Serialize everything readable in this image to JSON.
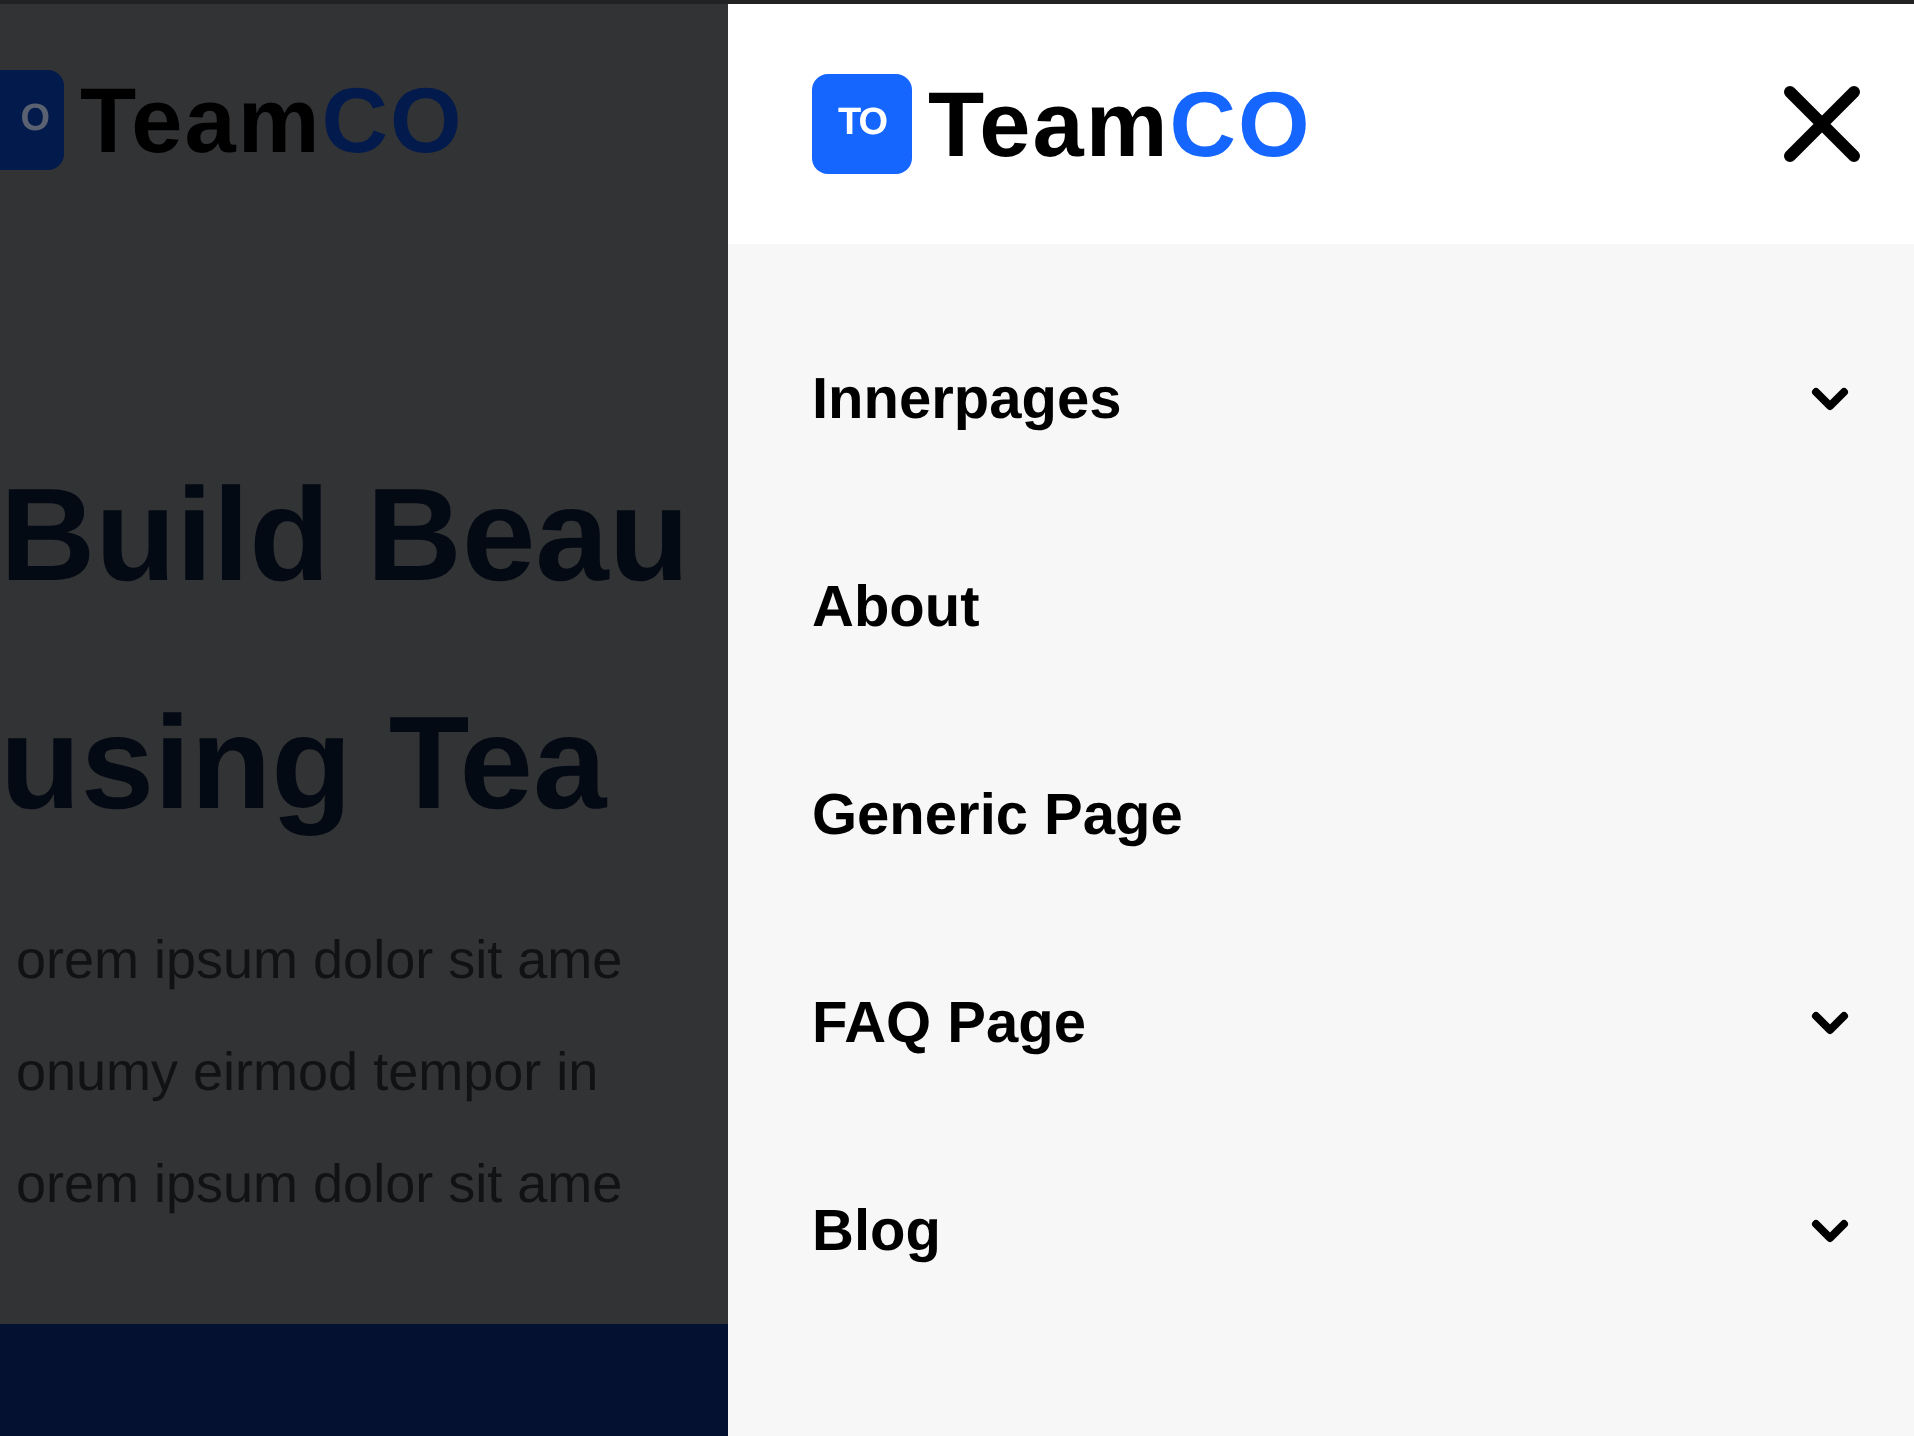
{
  "background_page": {
    "logo": {
      "badge": "O",
      "name": "Team",
      "accent": "CO"
    },
    "heading_lines": [
      "Build Beau",
      "using Tea"
    ],
    "paragraph_lines": [
      "orem ipsum dolor sit ame",
      "onumy eirmod tempor in",
      "orem ipsum dolor sit ame"
    ]
  },
  "drawer": {
    "logo": {
      "badge": "TO",
      "name": "Team",
      "accent": "CO"
    },
    "menu": [
      {
        "label": "Innerpages",
        "has_submenu": true
      },
      {
        "label": "About",
        "has_submenu": false
      },
      {
        "label": "Generic Page",
        "has_submenu": false
      },
      {
        "label": "FAQ Page",
        "has_submenu": true
      },
      {
        "label": "Blog",
        "has_submenu": true
      }
    ]
  }
}
